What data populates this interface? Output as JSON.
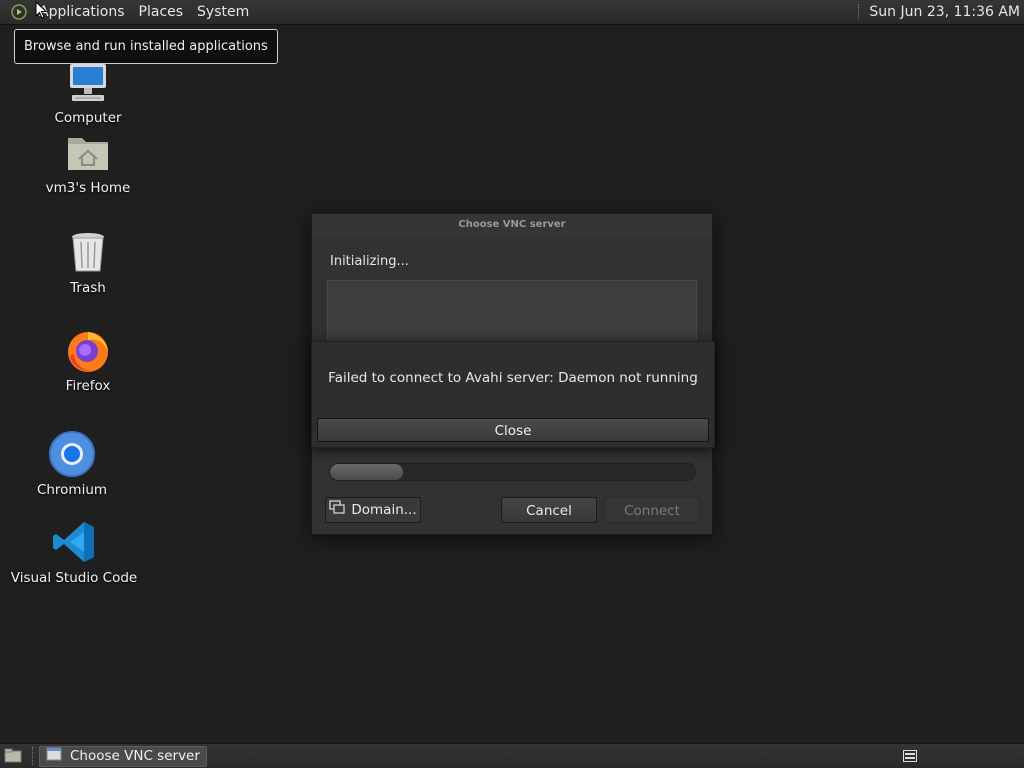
{
  "top_panel": {
    "menus": [
      "Applications",
      "Places",
      "System"
    ],
    "clock": "Sun Jun 23, 11:36 AM"
  },
  "tooltip": {
    "text": "Browse and run installed applications"
  },
  "desktop": {
    "icons": [
      {
        "label": "Computer",
        "icon": "computer-icon"
      },
      {
        "label": "vm3's Home",
        "icon": "home-folder-icon"
      },
      {
        "label": "Trash",
        "icon": "trash-icon"
      },
      {
        "label": "Firefox",
        "icon": "firefox-icon"
      },
      {
        "label": "Chromium",
        "icon": "chromium-icon"
      },
      {
        "label": "Visual Studio Code",
        "icon": "vscode-icon"
      }
    ]
  },
  "vnc_dialog": {
    "title": "Choose VNC server",
    "status": "Initializing...",
    "progress": 0.2,
    "buttons": {
      "domain": "Domain...",
      "cancel": "Cancel",
      "connect": "Connect"
    }
  },
  "error_dialog": {
    "message": "Failed to connect to Avahi server: Daemon not running",
    "close_label": "Close"
  },
  "taskbar": {
    "tasks": [
      {
        "label": "Choose VNC server",
        "active": true
      }
    ]
  }
}
